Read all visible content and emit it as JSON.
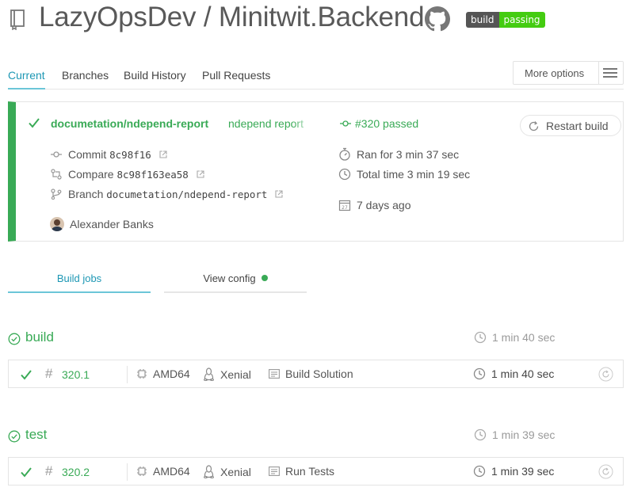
{
  "header": {
    "title": "LazyOpsDev / Minitwit.Backend",
    "badge_left": "build",
    "badge_right": "passing"
  },
  "tabs": [
    {
      "label": "Current",
      "active": true
    },
    {
      "label": "Branches",
      "active": false
    },
    {
      "label": "Build History",
      "active": false
    },
    {
      "label": "Pull Requests",
      "active": false
    }
  ],
  "more_options_label": "More options",
  "build": {
    "branch": "documetation/ndepend-report",
    "commit_message": "ndepend report",
    "commit_label": "Commit",
    "commit_sha": "8c98f16",
    "compare_label": "Compare",
    "compare_range": "8c98f163ea58",
    "branch_label": "Branch",
    "branch_value": "documetation/ndepend-report",
    "author": "Alexander Banks",
    "status": "#320 passed",
    "ran_for": "Ran for 3 min 37 sec",
    "total_time": "Total time 3 min 19 sec",
    "finished": "7 days ago",
    "restart_label": "Restart build"
  },
  "job_tabs": {
    "build_jobs": "Build jobs",
    "view_config": "View config"
  },
  "stages": [
    {
      "name": "build",
      "duration": "1 min 40 sec",
      "jobs": [
        {
          "number": "320.1",
          "arch": "AMD64",
          "dist": "Xenial",
          "name": "Build Solution",
          "duration": "1 min 40 sec"
        }
      ]
    },
    {
      "name": "test",
      "duration": "1 min 39 sec",
      "jobs": [
        {
          "number": "320.2",
          "arch": "AMD64",
          "dist": "Xenial",
          "name": "Run Tests",
          "duration": "1 min 39 sec"
        }
      ]
    }
  ],
  "colors": {
    "passed_green": "#39aa56",
    "link_blue": "#1d97b4",
    "tab_underline": "#6cc6d8",
    "badge_dark": "#555555",
    "badge_green": "#44cc11"
  }
}
